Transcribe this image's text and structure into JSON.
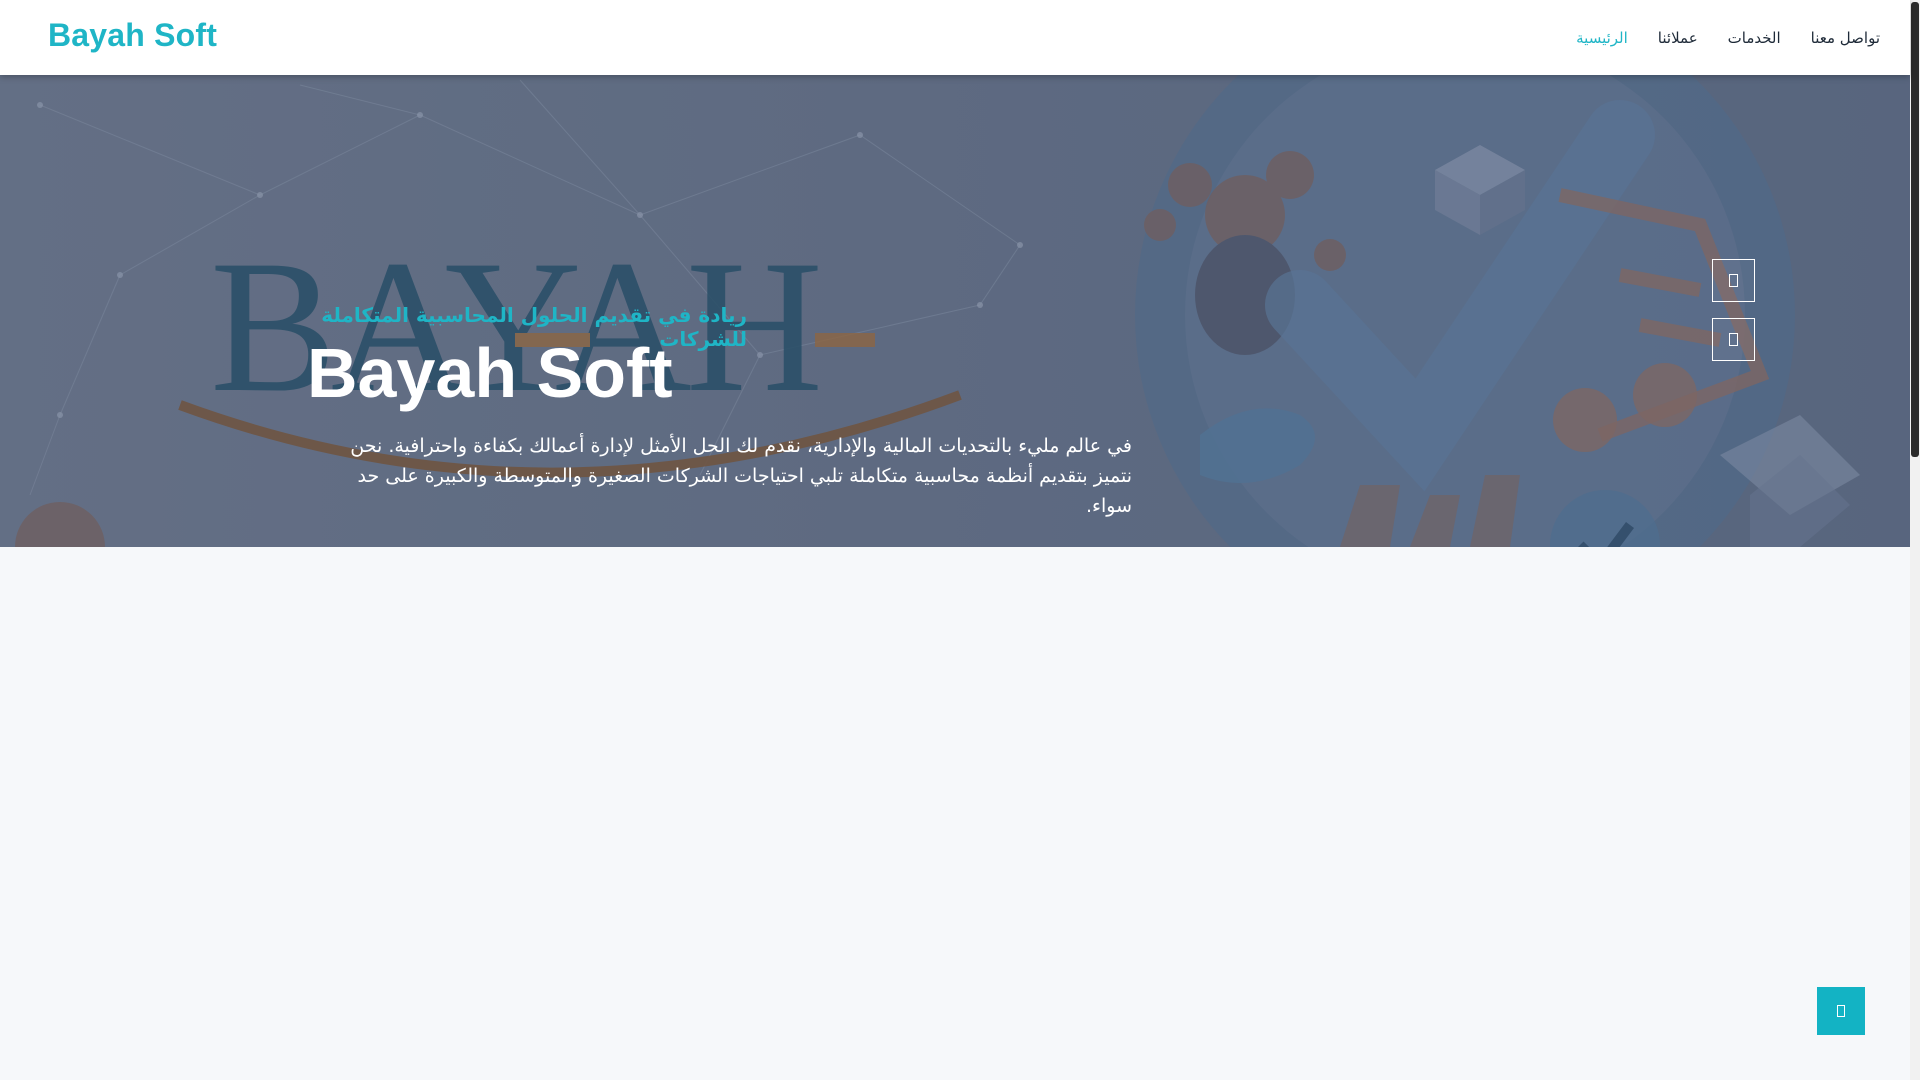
{
  "brand": "Bayah Soft",
  "nav": {
    "items": [
      {
        "label": "الرئيسية",
        "active": true
      },
      {
        "label": "عملائنا",
        "active": false
      },
      {
        "label": "الخدمات",
        "active": false
      },
      {
        "label": "تواصل معنا",
        "active": false
      }
    ]
  },
  "hero": {
    "logo_text": "BAYAH",
    "tagline": "ريادة في تقديم الحلول المحاسبية المتكاملة للشركات",
    "title": "Bayah Soft",
    "description": "في عالم مليء بالتحديات المالية والإدارية، نقدم لك الحل الأمثل لإدارة أعمالك بكفاءة واحترافية. نحن نتميز بتقديم أنظمة محاسبية متكاملة تلبي احتياجات الشركات الصغيرة والمتوسطة والكبيرة على حد سواء.",
    "slider_prev_icon": "square-glyph-icon",
    "slider_next_icon": "square-glyph-icon"
  },
  "back_to_top_icon": "arrow-up-icon",
  "colors": {
    "accent": "#1fb5c6",
    "text_dark": "#1e2a38",
    "hero_overlay": "#5e6b82",
    "page_bg": "#f6f8fa"
  }
}
